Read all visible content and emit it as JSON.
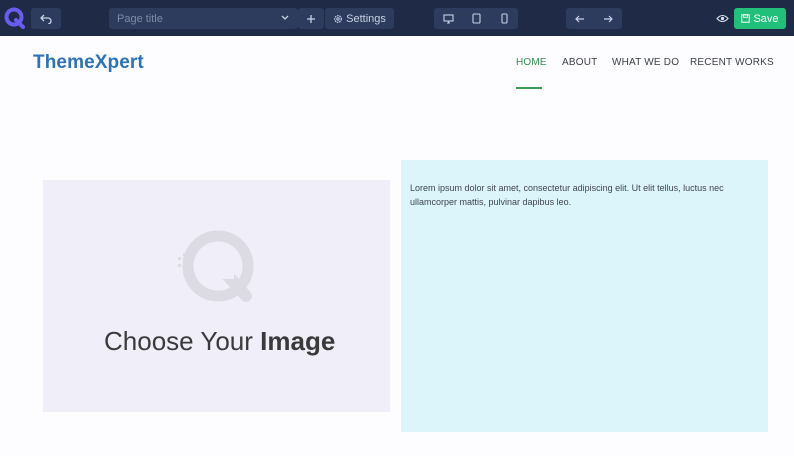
{
  "toolbar": {
    "page_title_placeholder": "Page title",
    "settings_label": "Settings",
    "save_label": "Save"
  },
  "site": {
    "brand": "ThemeXpert",
    "nav": [
      {
        "label": "HOME",
        "active": true
      },
      {
        "label": "ABOUT",
        "active": false
      },
      {
        "label": "WHAT WE DO",
        "active": false
      },
      {
        "label": "RECENT WORKS",
        "active": false
      }
    ]
  },
  "content": {
    "image_placeholder_light": "Choose Your",
    "image_placeholder_bold": "Image",
    "lorem": "Lorem ipsum dolor sit amet, consectetur adipiscing elit. Ut elit tellus, luctus nec ullamcorper mattis, pulvinar dapibus leo."
  },
  "colors": {
    "toolbar_bg": "#1f2b46",
    "save_green": "#21c07a",
    "brand_blue": "#2d72b8",
    "active_nav": "#2f8f4b",
    "text_box_bg": "#dcf5fb",
    "image_box_bg": "#f0eff9"
  },
  "icons": [
    "app-logo-icon",
    "undo-icon",
    "chevron-down-icon",
    "plus-icon",
    "gear-icon",
    "desktop-icon",
    "tablet-icon",
    "mobile-icon",
    "arrow-left-icon",
    "arrow-right-icon",
    "eye-icon",
    "save-icon",
    "image-placeholder-icon"
  ]
}
